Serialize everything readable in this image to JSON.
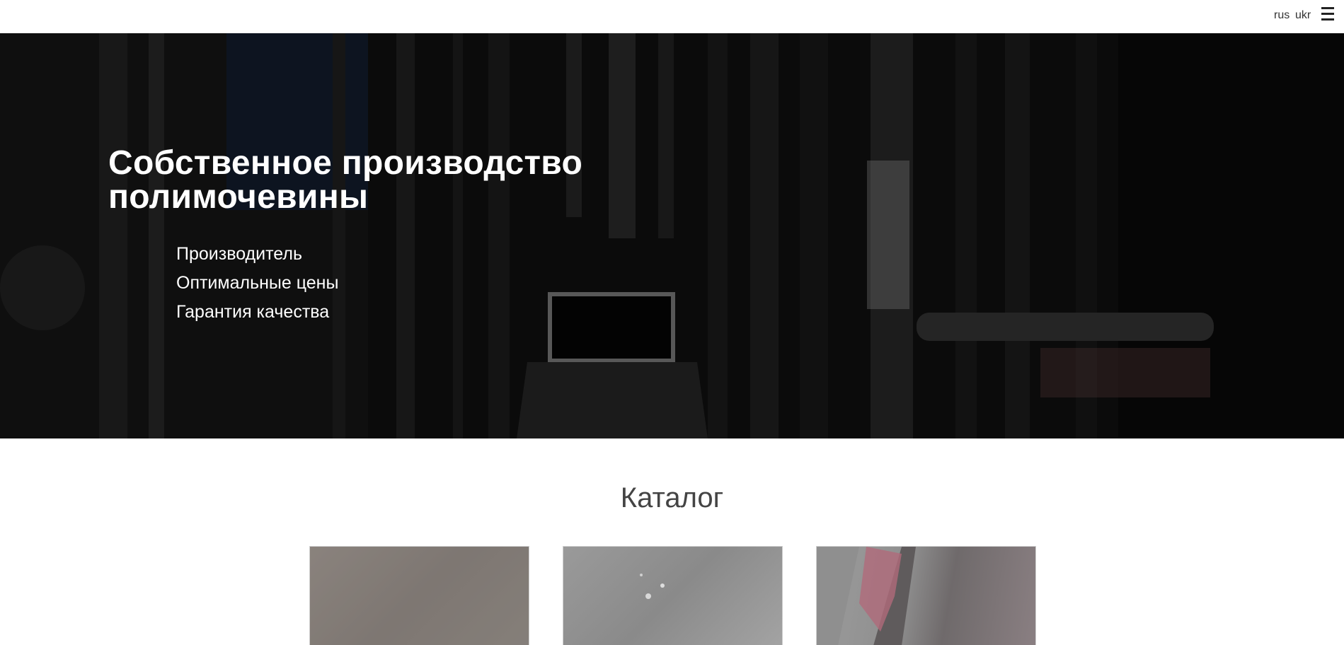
{
  "header": {
    "languages": [
      {
        "code": "rus",
        "label": "rus"
      },
      {
        "code": "ukr",
        "label": "ukr"
      }
    ],
    "menu_icon": "hamburger-menu-icon"
  },
  "hero": {
    "title_line1": "Собственное производство",
    "title_line2": "полимочевины",
    "features": [
      "Производитель",
      "Оптимальные цены",
      "Гарантия качества"
    ]
  },
  "catalog": {
    "title": "Каталог",
    "items": [
      {
        "image": "grey-speckled-surface"
      },
      {
        "image": "grey-concrete-surface"
      },
      {
        "image": "concrete-with-red-coating"
      }
    ]
  },
  "colors": {
    "header_bg": "#ffffff",
    "hero_overlay": "#0d0d0d",
    "hero_text": "#ffffff",
    "catalog_title": "#444444"
  }
}
